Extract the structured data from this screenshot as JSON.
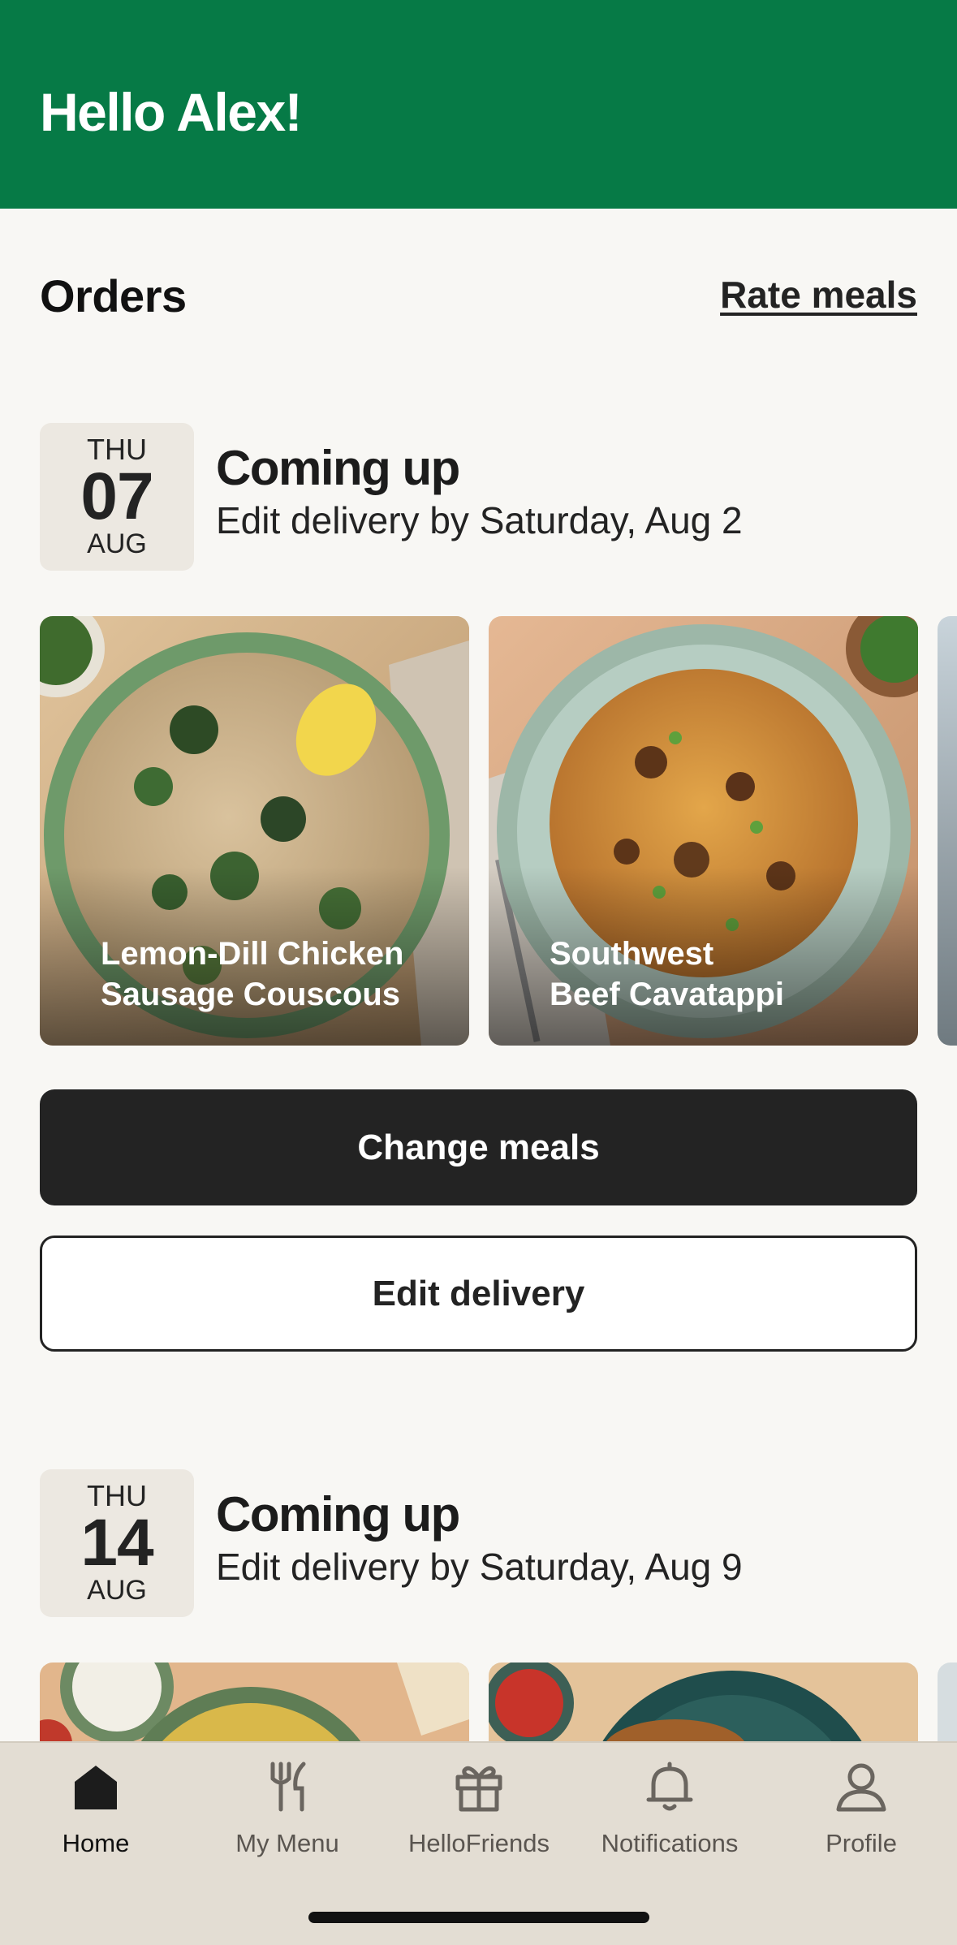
{
  "header": {
    "greeting": "Hello Alex!",
    "background": "#067a46"
  },
  "orders": {
    "title": "Orders",
    "rate_link": "Rate meals"
  },
  "deliveries": [
    {
      "weekday": "THU",
      "day": "07",
      "month": "AUG",
      "status": "Coming up",
      "deadline": "Edit delivery by Saturday, Aug 2",
      "meals": [
        {
          "name_line1": "Lemon-Dill Chicken",
          "name_line2": "Sausage Couscous"
        },
        {
          "name_line1": "Southwest",
          "name_line2": "Beef Cavatappi"
        }
      ],
      "primary_action": "Change meals",
      "secondary_action": "Edit delivery"
    },
    {
      "weekday": "THU",
      "day": "14",
      "month": "AUG",
      "status": "Coming up",
      "deadline": "Edit delivery by Saturday, Aug 9"
    }
  ],
  "nav": [
    {
      "label": "Home",
      "icon": "home-icon",
      "active": true
    },
    {
      "label": "My Menu",
      "icon": "fork-knife-icon",
      "active": false
    },
    {
      "label": "HelloFriends",
      "icon": "gift-icon",
      "active": false
    },
    {
      "label": "Notifications",
      "icon": "bell-icon",
      "active": false
    },
    {
      "label": "Profile",
      "icon": "person-icon",
      "active": false
    }
  ]
}
